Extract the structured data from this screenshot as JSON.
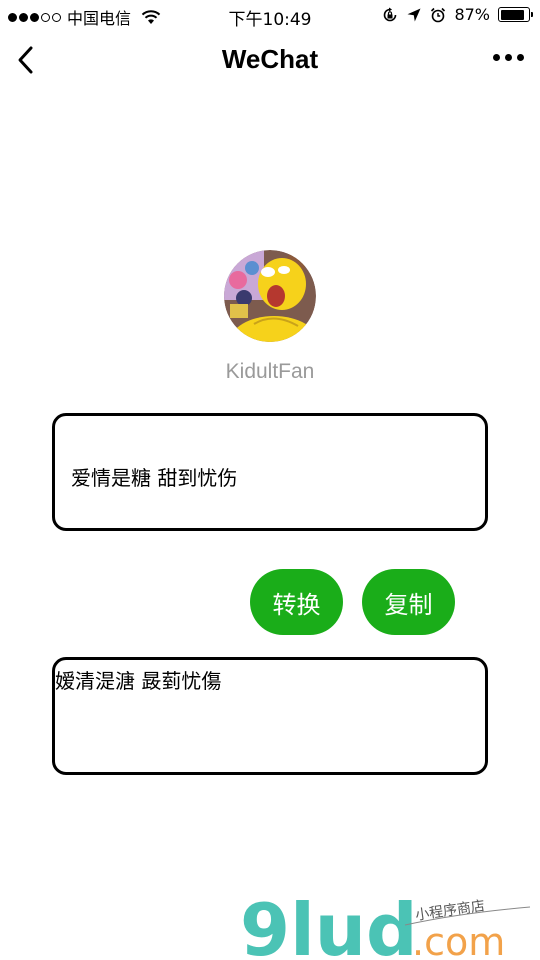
{
  "status_bar": {
    "carrier": "中国电信",
    "time": "下午10:49",
    "battery_percent": "87%",
    "battery_level": 0.87,
    "signal_bars_filled": 3,
    "signal_bars_total": 5,
    "icons": [
      "wifi-icon",
      "rotation-lock-icon",
      "location-icon",
      "alarm-icon",
      "battery-icon"
    ]
  },
  "nav": {
    "title": "WeChat",
    "back_icon": "chevron-left-icon",
    "more_icon": "more-dots-icon"
  },
  "profile": {
    "username": "KidultFan"
  },
  "converter": {
    "input_text": "爱情是糖 甜到忧伤",
    "convert_label": "转换",
    "copy_label": "复制",
    "output_text": "嫒清湜溏 晸菿忧傷",
    "accent_color": "#1aad19"
  },
  "watermark": {
    "brand": "9lud",
    "domain": ".com",
    "tagline": "小程序商店"
  }
}
